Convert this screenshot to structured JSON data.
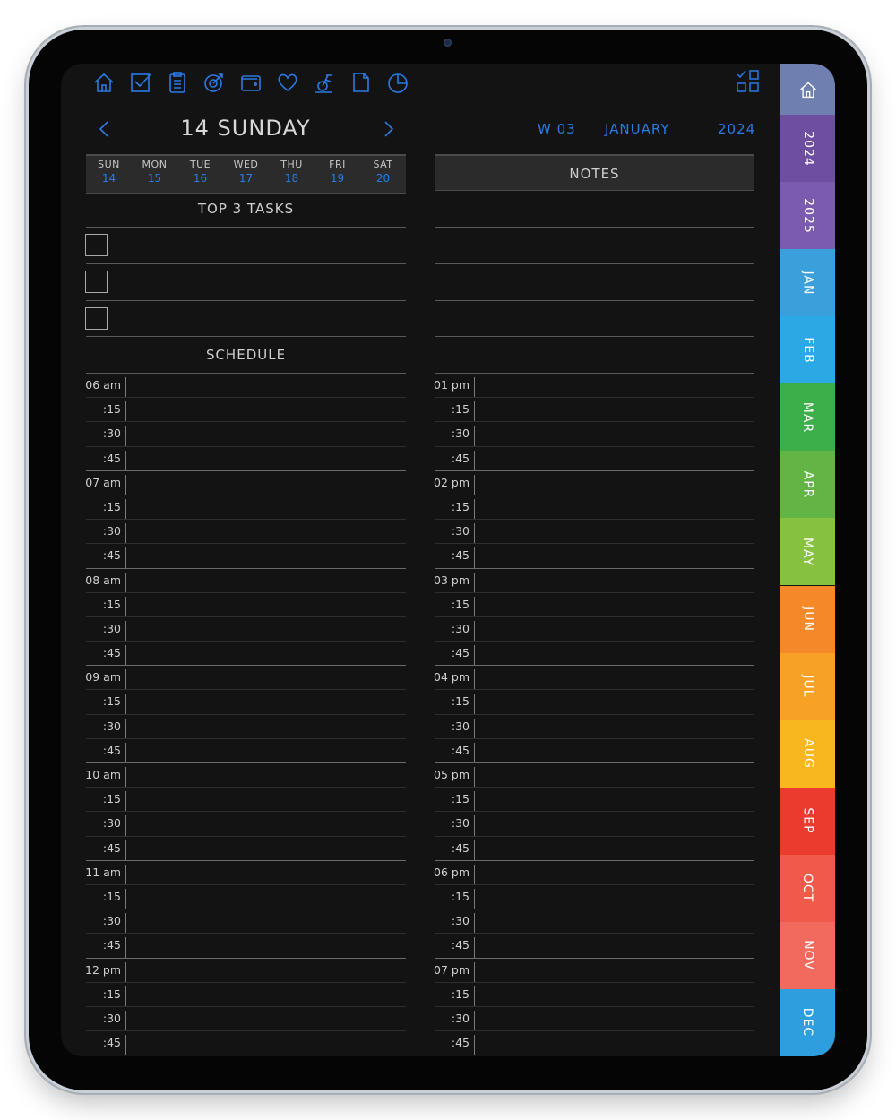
{
  "header": {
    "day_title": "14 SUNDAY",
    "week": "W 03",
    "month": "JANUARY",
    "year": "2024"
  },
  "toolbar_icons": [
    "home-icon",
    "check-square-icon",
    "clipboard-icon",
    "goal-icon",
    "wallet-icon",
    "heart-icon",
    "fitness-bike-icon",
    "document-icon",
    "pie-chart-icon"
  ],
  "week_strip": [
    {
      "name": "SUN",
      "date": "14"
    },
    {
      "name": "MON",
      "date": "15"
    },
    {
      "name": "TUE",
      "date": "16"
    },
    {
      "name": "WED",
      "date": "17"
    },
    {
      "name": "THU",
      "date": "18"
    },
    {
      "name": "FRI",
      "date": "19"
    },
    {
      "name": "SAT",
      "date": "20"
    }
  ],
  "sections": {
    "top_tasks": "TOP 3 TASKS",
    "schedule": "SCHEDULE",
    "notes": "NOTES"
  },
  "schedule_left": [
    "06 am",
    "07 am",
    "08 am",
    "09 am",
    "10 am",
    "11 am",
    "12 pm"
  ],
  "schedule_right": [
    "01 pm",
    "02 pm",
    "03 pm",
    "04 pm",
    "05 pm",
    "06 pm",
    "07 pm"
  ],
  "quarters": [
    ":15",
    ":30",
    ":45"
  ],
  "side_tabs": [
    {
      "label": "",
      "icon": "home-icon",
      "color": "#6f7fb0"
    },
    {
      "label": "2024",
      "color": "#6d4ea0"
    },
    {
      "label": "2025",
      "color": "#7a5bb0"
    },
    {
      "label": "JAN",
      "color": "#3b9fdc"
    },
    {
      "label": "FEB",
      "color": "#2aa9e4"
    },
    {
      "label": "MAR",
      "color": "#3cae4a"
    },
    {
      "label": "APR",
      "color": "#62b544"
    },
    {
      "label": "MAY",
      "color": "#86c23f"
    },
    {
      "label": "JUN",
      "color": "#f5892a"
    },
    {
      "label": "JUL",
      "color": "#f7a224"
    },
    {
      "label": "AUG",
      "color": "#f8b71e"
    },
    {
      "label": "SEP",
      "color": "#ea3b2e"
    },
    {
      "label": "OCT",
      "color": "#ef5a4b"
    },
    {
      "label": "NOV",
      "color": "#f26a5e"
    },
    {
      "label": "DEC",
      "color": "#2e9ede"
    }
  ],
  "colors": {
    "accent": "#2a7be4",
    "screen": "#131313"
  }
}
